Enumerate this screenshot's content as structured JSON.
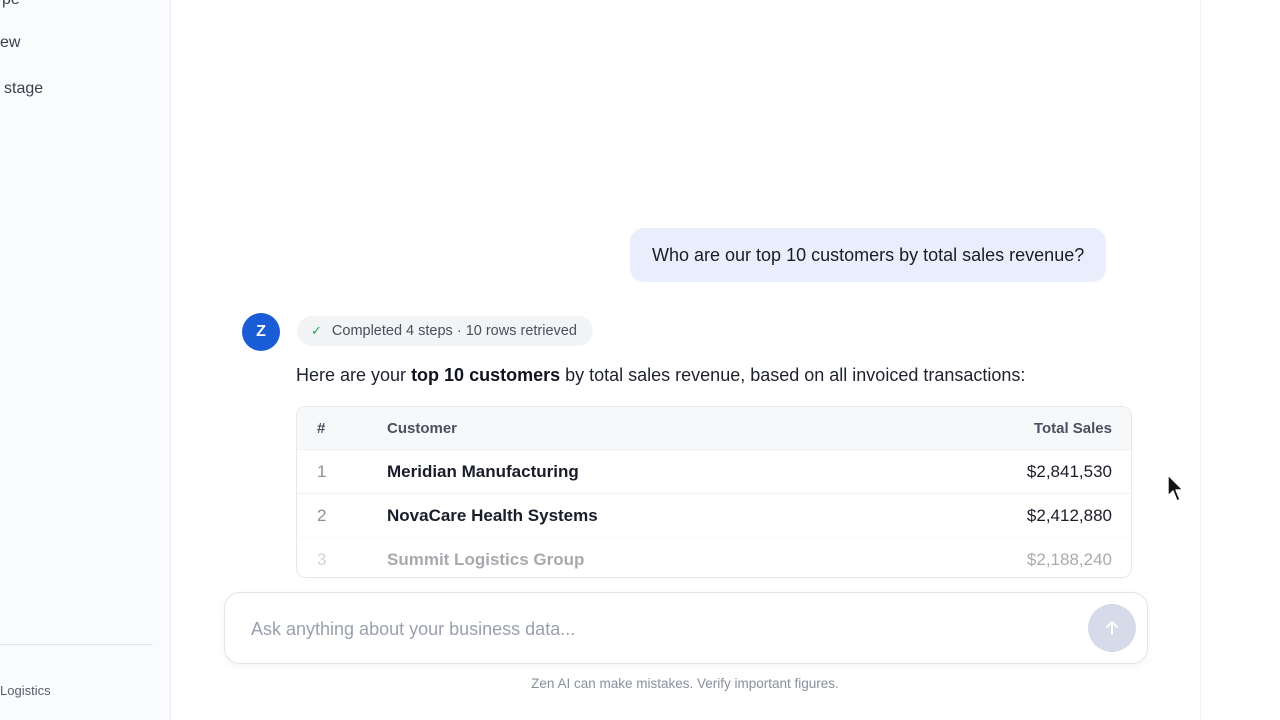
{
  "sidebar": {
    "items": [
      {
        "label": "ype"
      },
      {
        "label": "ew"
      },
      {
        "label": "stage"
      }
    ],
    "org_name": "Logistics"
  },
  "conversation": {
    "user_message": "Who are our top 10 customers by total sales revenue?",
    "assistant": {
      "avatar_letter": "Z",
      "status": "Completed 4 steps · 10 rows retrieved",
      "intro_prefix": "Here are your ",
      "intro_bold": "top 10 customers",
      "intro_suffix": " by total sales revenue, based on all invoiced transactions:"
    }
  },
  "table": {
    "headers": {
      "num": "#",
      "customer": "Customer",
      "total": "Total Sales"
    },
    "rows": [
      {
        "num": "1",
        "customer": "Meridian Manufacturing",
        "total": "$2,841,530"
      },
      {
        "num": "2",
        "customer": "NovaCare Health Systems",
        "total": "$2,412,880"
      },
      {
        "num": "3",
        "customer": "Summit Logistics Group",
        "total": "$2,188,240"
      }
    ]
  },
  "composer": {
    "placeholder": "Ask anything about your business data..."
  },
  "disclaimer": "Zen AI can make mistakes. Verify important figures.",
  "colors": {
    "accent": "#1a5bd6",
    "user_bubble": "#e8eefb",
    "success": "#1f9d55"
  }
}
